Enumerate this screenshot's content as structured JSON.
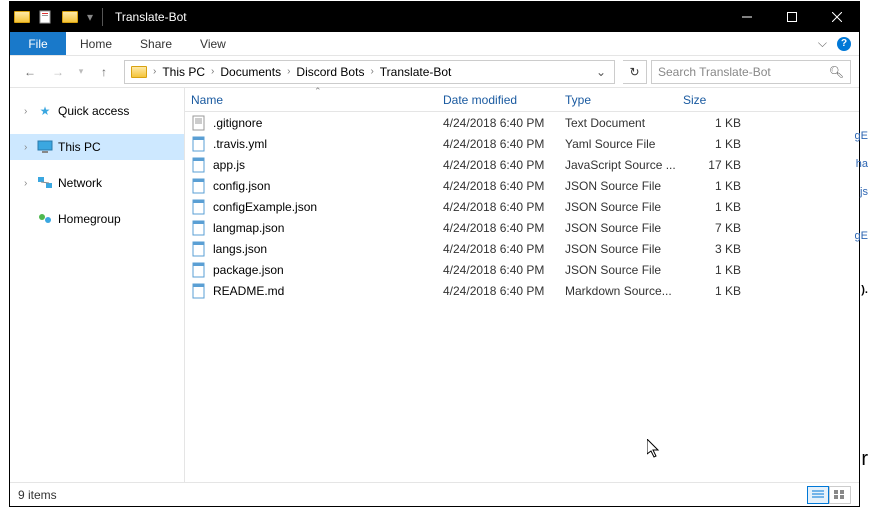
{
  "window": {
    "title": "Translate-Bot"
  },
  "ribbon": {
    "file": "File",
    "tabs": [
      "Home",
      "Share",
      "View"
    ]
  },
  "breadcrumb": {
    "items": [
      "This PC",
      "Documents",
      "Discord Bots",
      "Translate-Bot"
    ]
  },
  "search": {
    "placeholder": "Search Translate-Bot"
  },
  "nav": {
    "quick_access": "Quick access",
    "this_pc": "This PC",
    "network": "Network",
    "homegroup": "Homegroup"
  },
  "columns": {
    "name": "Name",
    "date": "Date modified",
    "type": "Type",
    "size": "Size"
  },
  "files": [
    {
      "icon": "text",
      "name": ".gitignore",
      "date": "4/24/2018 6:40 PM",
      "type": "Text Document",
      "size": "1 KB"
    },
    {
      "icon": "yaml",
      "name": ".travis.yml",
      "date": "4/24/2018 6:40 PM",
      "type": "Yaml Source File",
      "size": "1 KB"
    },
    {
      "icon": "js",
      "name": "app.js",
      "date": "4/24/2018 6:40 PM",
      "type": "JavaScript Source ...",
      "size": "17 KB"
    },
    {
      "icon": "json",
      "name": "config.json",
      "date": "4/24/2018 6:40 PM",
      "type": "JSON Source File",
      "size": "1 KB"
    },
    {
      "icon": "json",
      "name": "configExample.json",
      "date": "4/24/2018 6:40 PM",
      "type": "JSON Source File",
      "size": "1 KB"
    },
    {
      "icon": "json",
      "name": "langmap.json",
      "date": "4/24/2018 6:40 PM",
      "type": "JSON Source File",
      "size": "7 KB"
    },
    {
      "icon": "json",
      "name": "langs.json",
      "date": "4/24/2018 6:40 PM",
      "type": "JSON Source File",
      "size": "3 KB"
    },
    {
      "icon": "json",
      "name": "package.json",
      "date": "4/24/2018 6:40 PM",
      "type": "JSON Source File",
      "size": "1 KB"
    },
    {
      "icon": "md",
      "name": "README.md",
      "date": "4/24/2018 6:40 PM",
      "type": "Markdown Source...",
      "size": "1 KB"
    }
  ],
  "status": {
    "count": "9 items"
  },
  "rightstrip": [
    "gE",
    "ha",
    "js",
    "gE",
    ").",
    "r"
  ]
}
